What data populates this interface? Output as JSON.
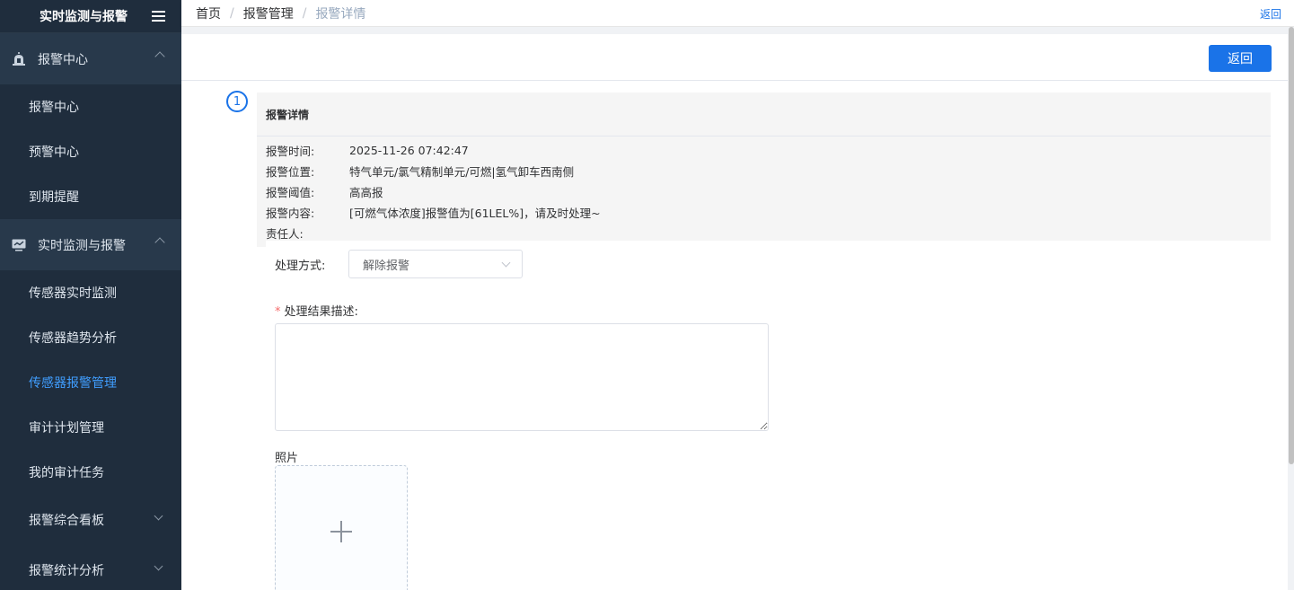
{
  "sidebar": {
    "title": "实时监测与报警",
    "groups": [
      {
        "label": "报警中心",
        "icon": "alarm-light-icon",
        "items": [
          "报警中心",
          "预警中心",
          "到期提醒"
        ]
      },
      {
        "label": "实时监测与报警",
        "icon": "monitor-chart-icon",
        "items": [
          "传感器实时监测",
          "传感器趋势分析",
          "传感器报警管理",
          "审计计划管理",
          "我的审计任务"
        ]
      }
    ],
    "active_item": "传感器报警管理",
    "collapsed_items": [
      "报警综合看板",
      "报警统计分析"
    ],
    "active_color": "#409eff"
  },
  "breadcrumb": [
    "首页",
    "报警管理",
    "报警详情"
  ],
  "topbar": {
    "back_link": "返回"
  },
  "header": {
    "back_button": "返回"
  },
  "step": {
    "number": "1"
  },
  "detail": {
    "title": "报警详情",
    "fields": [
      {
        "label": "报警时间:",
        "value": "2025-11-26 07:42:47"
      },
      {
        "label": "报警位置:",
        "value": "特气单元/氯气精制单元/可燃|氢气卸车西南侧"
      },
      {
        "label": "报警阈值:",
        "value": "高高报"
      },
      {
        "label": "报警内容:",
        "value": "[可燃气体浓度]报警值为[61LEL%]，请及时处理~"
      },
      {
        "label": "责任人:",
        "value": ""
      }
    ]
  },
  "form": {
    "method_label": "处理方式:",
    "method_value": "解除报警",
    "result_label": "处理结果描述:",
    "result_value": "",
    "photo_label": "照片"
  },
  "colors": {
    "primary": "#1a73e8",
    "sidebar_bg": "#1f2d3d"
  }
}
